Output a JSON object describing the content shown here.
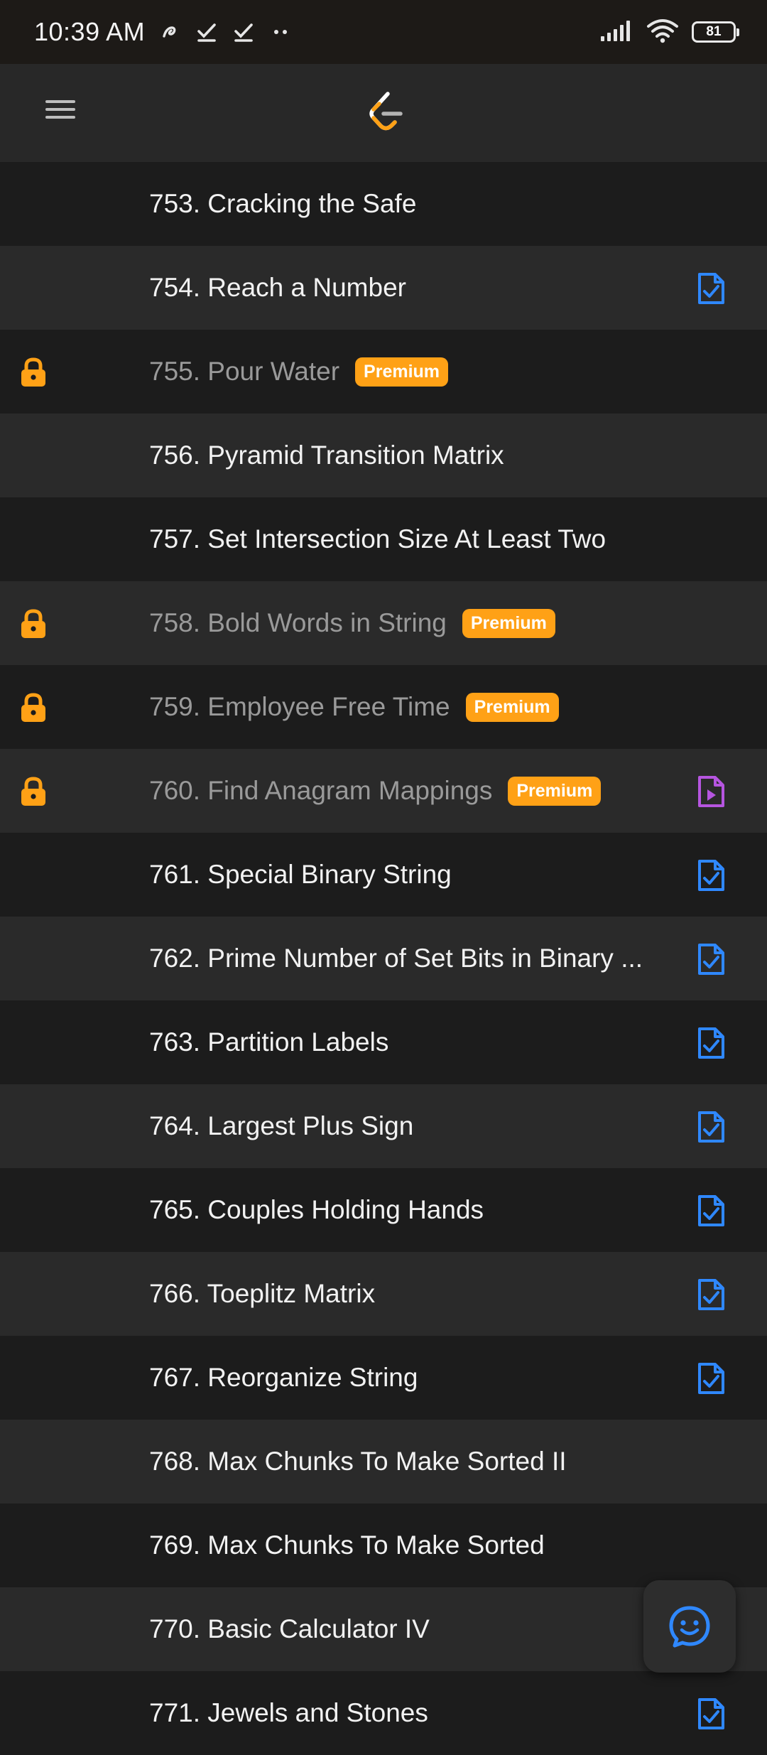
{
  "status_bar": {
    "time": "10:39 AM",
    "battery": "81",
    "icons": [
      "nfc-icon",
      "check-icon",
      "check-icon",
      "dots-icon",
      "signal-icon",
      "wifi-icon",
      "battery-icon"
    ]
  },
  "header": {
    "menu_icon": "hamburger-icon",
    "logo": "leetcode-logo"
  },
  "colors": {
    "accent": "#ffa116",
    "solution_blue": "#2f88ff",
    "video_purple": "#b655e0"
  },
  "premium_label": "Premium",
  "problems": [
    {
      "title": "753. Cracking the Safe",
      "locked": false,
      "status": "none"
    },
    {
      "title": "754. Reach a Number",
      "locked": false,
      "status": "solution"
    },
    {
      "title": "755. Pour Water",
      "locked": true,
      "status": "none"
    },
    {
      "title": "756. Pyramid Transition Matrix",
      "locked": false,
      "status": "none"
    },
    {
      "title": "757. Set Intersection Size At Least Two",
      "locked": false,
      "status": "none"
    },
    {
      "title": "758. Bold Words in String",
      "locked": true,
      "status": "none"
    },
    {
      "title": "759. Employee Free Time",
      "locked": true,
      "status": "none"
    },
    {
      "title": "760. Find Anagram Mappings",
      "locked": true,
      "status": "video"
    },
    {
      "title": "761. Special Binary String",
      "locked": false,
      "status": "solution"
    },
    {
      "title": "762. Prime Number of Set Bits in Binary ...",
      "locked": false,
      "status": "solution"
    },
    {
      "title": "763. Partition Labels",
      "locked": false,
      "status": "solution"
    },
    {
      "title": "764. Largest Plus Sign",
      "locked": false,
      "status": "solution"
    },
    {
      "title": "765. Couples Holding Hands",
      "locked": false,
      "status": "solution"
    },
    {
      "title": "766. Toeplitz Matrix",
      "locked": false,
      "status": "solution"
    },
    {
      "title": "767. Reorganize String",
      "locked": false,
      "status": "solution"
    },
    {
      "title": "768. Max Chunks To Make Sorted II",
      "locked": false,
      "status": "none"
    },
    {
      "title": "769. Max Chunks To Make Sorted",
      "locked": false,
      "status": "none"
    },
    {
      "title": "770. Basic Calculator IV",
      "locked": false,
      "status": "none"
    },
    {
      "title": "771. Jewels and Stones",
      "locked": false,
      "status": "solution"
    }
  ],
  "fab": {
    "icon": "chat-feedback-icon"
  }
}
